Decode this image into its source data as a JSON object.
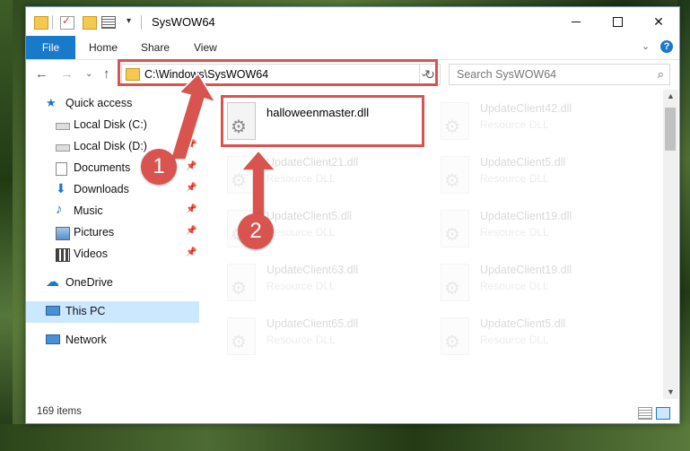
{
  "window": {
    "title": "SysWOW64",
    "controls": {
      "minimize": "",
      "maximize": "",
      "close": "✕"
    }
  },
  "quick_access_toolbar": {
    "dropdown": "▾"
  },
  "ribbon": {
    "file": "File",
    "tabs": [
      "Home",
      "Share",
      "View"
    ],
    "expand": "⌄",
    "help": "?"
  },
  "navigation": {
    "back": "←",
    "forward": "→",
    "recent": "⌄",
    "up": "↑",
    "address": "C:\\Windows\\SysWOW64",
    "address_dropdown": "⌄",
    "refresh": "↻",
    "search_placeholder": "Search SysWOW64",
    "search_icon": "⌕"
  },
  "sidebar": {
    "quick_access": "Quick access",
    "items": [
      {
        "label": "Local Disk (C:)",
        "icon": "drive-icon",
        "pinned": true
      },
      {
        "label": "Local Disk (D:)",
        "icon": "drive-icon",
        "pinned": true
      },
      {
        "label": "Documents",
        "icon": "documents-icon",
        "pinned": true
      },
      {
        "label": "Downloads",
        "icon": "downloads-icon",
        "pinned": true
      },
      {
        "label": "Music",
        "icon": "music-icon",
        "pinned": true
      },
      {
        "label": "Pictures",
        "icon": "pictures-icon",
        "pinned": true
      },
      {
        "label": "Videos",
        "icon": "videos-icon",
        "pinned": true
      }
    ],
    "onedrive": "OneDrive",
    "this_pc": "This PC",
    "network": "Network",
    "pin_glyph": "📌"
  },
  "files": {
    "main": {
      "name": "halloweenmaster.dll"
    },
    "left_column": [
      {
        "name": "UpdateClient21.dll",
        "type": "Resource DLL"
      },
      {
        "name": "UpdateClient5.dll",
        "type": "Resource DLL"
      },
      {
        "name": "UpdateClient63.dll",
        "type": "Resource DLL"
      },
      {
        "name": "UpdateClient65.dll",
        "type": "Resource DLL"
      }
    ],
    "right_column": [
      {
        "name": "UpdateClient42.dll",
        "type": "Resource DLL"
      },
      {
        "name": "UpdateClient5.dll",
        "type": "Resource DLL"
      },
      {
        "name": "UpdateClient19.dll",
        "type": "Resource DLL"
      },
      {
        "name": "UpdateClient19.dll",
        "type": "Resource DLL"
      },
      {
        "name": "UpdateClient5.dll",
        "type": "Resource DLL"
      }
    ]
  },
  "scrollbar": {
    "up": "▲",
    "down": "▼"
  },
  "status": {
    "item_count": "169 items"
  },
  "annotations": {
    "step1": "1",
    "step2": "2",
    "color": "#d9534f"
  }
}
